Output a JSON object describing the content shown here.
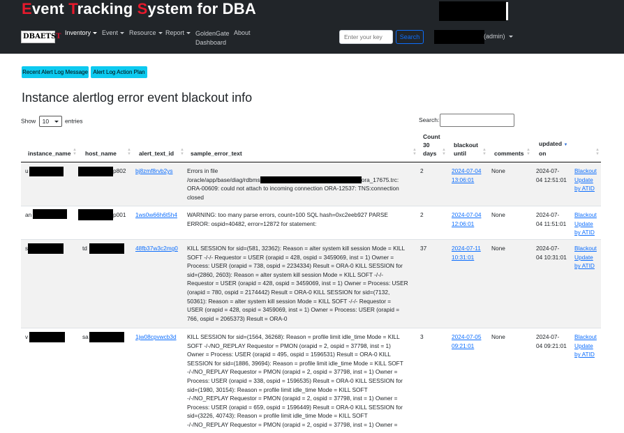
{
  "app": {
    "title_letters": [
      {
        "first": "E",
        "rest": "vent "
      },
      {
        "first": "T",
        "rest": "racking "
      },
      {
        "first": "S",
        "rest": "ystem for DBA"
      }
    ],
    "logo_text_a": "DBAETS",
    "logo_text_b": "T"
  },
  "nav": {
    "items": [
      "Inventory",
      "Event",
      "Resource",
      "Report"
    ],
    "goldengate_line1": "GoldenGate",
    "goldengate_line2": "Dashboard",
    "about": "About"
  },
  "search": {
    "placeholder": "Enter your key",
    "button": "Search"
  },
  "user": {
    "role": "(admin)"
  },
  "actions": {
    "recent": "Recent Alert Log Message",
    "plan": "Alert Log Action Plan"
  },
  "page": {
    "title": "Instance alertlog error event blackout info"
  },
  "table_controls": {
    "show": "Show",
    "entries_value": "10",
    "entries": "entries",
    "search_label": "Search:"
  },
  "columns": [
    {
      "line1": "instance_name",
      "line2": "",
      "line3": ""
    },
    {
      "line1": "host_name",
      "line2": "",
      "line3": ""
    },
    {
      "line1": "alert_text_id",
      "line2": "",
      "line3": ""
    },
    {
      "line1": "sample_error_text",
      "line2": "",
      "line3": ""
    },
    {
      "line1": "Count",
      "line2": "30",
      "line3": "days"
    },
    {
      "line1": "blackout",
      "line2": "until",
      "line3": ""
    },
    {
      "line1": "comments",
      "line2": "",
      "line3": ""
    },
    {
      "line1": "updated",
      "line2": "on",
      "line3": ""
    },
    {
      "line1": "",
      "line2": "",
      "line3": ""
    }
  ],
  "rows": [
    {
      "inst": "u",
      "host": "p802",
      "alert_id": "bj8zmf8rvb2ys",
      "text_lines": [
        "Errors in file",
        "/oracle/app/base/diag/rdbms",
        "ORA-00609: could not attach to incoming connection ORA-12537: TNS:connection",
        "closed"
      ],
      "text_after_redact": "ora_17675.trc:",
      "count": "2",
      "blackout": [
        "2024-07-04",
        "13:06:01"
      ],
      "comments": "None",
      "updated": [
        "2024-07-",
        "04 12:51:01"
      ],
      "act": [
        "Blackout",
        "Update",
        "by ATID"
      ]
    },
    {
      "inst": "an",
      "host": "p001",
      "alert_id": "1ws0w66h6t5h4",
      "text_lines": [
        "WARNING: too many parse errors, count=100 SQL hash=0xc2eeb927 PARSE",
        "ERROR: ospid=40482, error=12872 for statement:"
      ],
      "count": "2",
      "blackout": [
        "2024-07-04",
        "12:06:01"
      ],
      "comments": "None",
      "updated": [
        "2024-07-",
        "04 11:51:01"
      ],
      "act": [
        "Blackout",
        "Update",
        "by ATID"
      ]
    },
    {
      "inst": "s",
      "host": "td",
      "alert_id": "48fb37w3c2mg0",
      "text_lines": [
        "KILL SESSION for sid=(581, 32362): Reason = alter system kill session Mode = KILL",
        "SOFT -/-/- Requestor = USER (orapid = 428, ospid = 3459069, inst = 1) Owner =",
        "Process: USER (orapid = 738, ospid = 2234334) Result = ORA-0 KILL SESSION for",
        "sid=(2860, 2603): Reason = alter system kill session Mode = KILL SOFT -/-/-",
        "Requestor = USER (orapid = 428, ospid = 3459069, inst = 1) Owner = Process: USER",
        "(orapid = 780, ospid = 2174442) Result = ORA-0 KILL SESSION for sid=(7132,",
        "50361): Reason = alter system kill session Mode = KILL SOFT -/-/- Requestor =",
        "USER (orapid = 428, ospid = 3459069, inst = 1) Owner = Process: USER (orapid =",
        "766, ospid = 2065373) Result = ORA-0"
      ],
      "count": "37",
      "blackout": [
        "2024-07-11",
        "10:31:01"
      ],
      "comments": "None",
      "updated": [
        "2024-07-",
        "04 10:31:01"
      ],
      "act": [
        "Blackout",
        "Update",
        "by ATID"
      ]
    },
    {
      "inst": "v",
      "host": "sa",
      "alert_id": "1jw08cpvwcb3d",
      "text_lines": [
        "KILL SESSION for sid=(1564, 36268): Reason = profile limit idle_time Mode = KILL",
        "SOFT -/-/NO_REPLAY Requestor = PMON (orapid = 2, ospid = 37798, inst = 1)",
        "Owner = Process: USER (orapid = 495, ospid = 1596531) Result = ORA-0 KILL",
        "SESSION for sid=(1886, 39694): Reason = profile limit idle_time Mode = KILL SOFT",
        "-/-/NO_REPLAY Requestor = PMON (orapid = 2, ospid = 37798, inst = 1) Owner =",
        "Process: USER (orapid = 338, ospid = 1596535) Result = ORA-0 KILL SESSION for",
        "sid=(1980, 30154): Reason = profile limit idle_time Mode = KILL SOFT",
        "-/-/NO_REPLAY Requestor = PMON (orapid = 2, ospid = 37798, inst = 1) Owner =",
        "Process: USER (orapid = 659, ospid = 1596449) Result = ORA-0 KILL SESSION for",
        "sid=(3226, 40743): Reason = profile limit idle_time Mode = KILL SOFT",
        "-/-/NO_REPLAY Requestor = PMON (orapid = 2, ospid = 37798, inst = 1) Owner ="
      ],
      "count": "3",
      "blackout": [
        "2024-07-05",
        "09:21:01"
      ],
      "comments": "None",
      "updated": [
        "2024-07-",
        "04 09:21:01"
      ],
      "act": [
        "Blackout",
        "Update",
        "by ATID"
      ]
    }
  ],
  "colors": {
    "header_bg": "#212529",
    "accent_red": "#e8192c",
    "info_button": "#0dcaf0",
    "link": "#0d6efd",
    "stripe": "#f2f2f2"
  }
}
